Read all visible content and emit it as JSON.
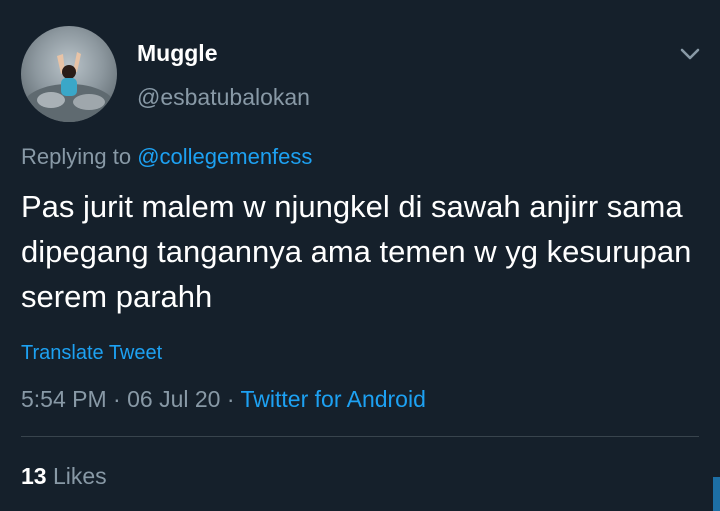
{
  "tweet": {
    "author": {
      "display_name": "Muggle",
      "handle": "@esbatubalokan",
      "avatar_icon": "profile-photo"
    },
    "menu_icon": "chevron-down-icon",
    "replying_prefix": "Replying to",
    "replying_to": "@collegemenfess",
    "text": "Pas jurit malem w njungkel di sawah anjirr sama dipegang tangannya ama temen w yg kesurupan serem parahh",
    "translate_label": "Translate Tweet",
    "time": "5:54 PM",
    "separator": "·",
    "date": "06 Jul 20",
    "source": "Twitter for Android",
    "likes_count": "13",
    "likes_label": "Likes"
  },
  "colors": {
    "background": "#15202b",
    "text_primary": "#ffffff",
    "text_secondary": "#8899a6",
    "link": "#1da1f2",
    "divider": "#38444d"
  }
}
